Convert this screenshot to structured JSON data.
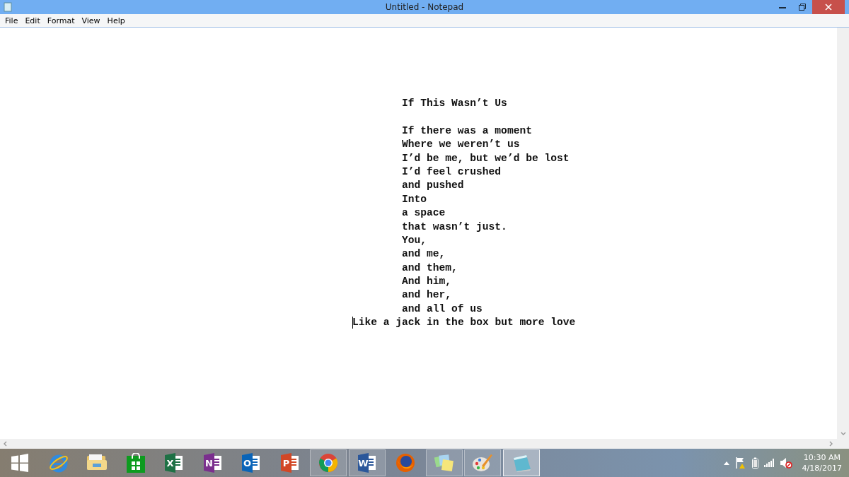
{
  "window": {
    "title": "Untitled - Notepad"
  },
  "menu": [
    "File",
    "Edit",
    "Format",
    "View",
    "Help"
  ],
  "document": {
    "title": "If This Wasn’t Us",
    "lines": [
      {
        "text": "If there was a moment",
        "kind": "indented",
        "caret": false
      },
      {
        "text": "Where we weren’t us",
        "kind": "indented",
        "caret": false
      },
      {
        "text": "I’d be me, but we’d be lost",
        "kind": "indented",
        "caret": false
      },
      {
        "text": "I’d feel crushed",
        "kind": "indented",
        "caret": false
      },
      {
        "text": "and pushed",
        "kind": "indented",
        "caret": false
      },
      {
        "text": "Into",
        "kind": "indented",
        "caret": false
      },
      {
        "text": "a space",
        "kind": "indented",
        "caret": false
      },
      {
        "text": "that wasn’t just.",
        "kind": "indented",
        "caret": false
      },
      {
        "text": "You,",
        "kind": "indented",
        "caret": false
      },
      {
        "text": "and me,",
        "kind": "indented",
        "caret": false
      },
      {
        "text": "and them,",
        "kind": "indented",
        "caret": false
      },
      {
        "text": "And him,",
        "kind": "indented",
        "caret": false
      },
      {
        "text": "and her,",
        "kind": "indented",
        "caret": false
      },
      {
        "text": "and all of us",
        "kind": "indented",
        "caret": false
      },
      {
        "text": "Like a jack in the box but more love",
        "kind": "plain",
        "caret": true
      }
    ]
  },
  "taskbar": {
    "apps": [
      {
        "kind": "start",
        "running": false,
        "selected": false
      },
      {
        "kind": "ie",
        "running": false,
        "selected": false
      },
      {
        "kind": "explorer",
        "running": false,
        "selected": false
      },
      {
        "kind": "store",
        "running": false,
        "selected": false
      },
      {
        "kind": "office",
        "letter": "X",
        "color": "#1e7145",
        "running": false,
        "selected": false
      },
      {
        "kind": "office",
        "letter": "N",
        "color": "#7b2f8e",
        "running": false,
        "selected": false
      },
      {
        "kind": "office",
        "letter": "O",
        "color": "#0a64b8",
        "running": false,
        "selected": false
      },
      {
        "kind": "office",
        "letter": "P",
        "color": "#d24726",
        "running": false,
        "selected": false
      },
      {
        "kind": "chrome",
        "running": true,
        "selected": false
      },
      {
        "kind": "office",
        "letter": "W",
        "color": "#2b579a",
        "running": true,
        "selected": false
      },
      {
        "kind": "firefox",
        "running": false,
        "selected": false
      },
      {
        "kind": "sticky",
        "running": true,
        "selected": false
      },
      {
        "kind": "paint",
        "running": true,
        "selected": false
      },
      {
        "kind": "notepad",
        "running": true,
        "selected": true
      }
    ],
    "clock": {
      "time": "10:30 AM",
      "date": "4/18/2017"
    }
  }
}
